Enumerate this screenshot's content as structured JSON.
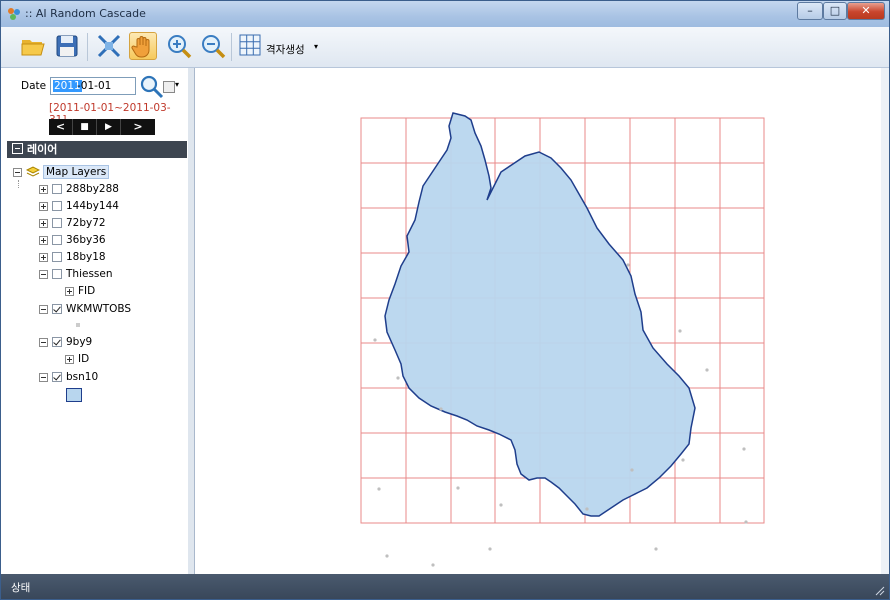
{
  "window": {
    "title": ":: AI Random Cascade",
    "minimize_label": "–",
    "maximize_label": "□",
    "close_label": "✕"
  },
  "toolbar": {
    "grid_create_label": "격자생성",
    "grid_create_arrow": "▾",
    "buttons": [
      "open-folder-icon",
      "save-icon",
      "zoom-extent-icon",
      "pan-hand-icon",
      "zoom-in-icon",
      "zoom-out-icon",
      "grid-icon"
    ]
  },
  "date_panel": {
    "date_label": "Date",
    "date_year_selected": "2011",
    "date_rest": "-01-01",
    "range_text": "[2011-01-01~2011-03-31]",
    "nav": {
      "prev": "<",
      "stop": "■",
      "play": "▶",
      "next": ">"
    }
  },
  "layers_panel": {
    "header": "레이어",
    "root": "Map Layers",
    "items": [
      {
        "label": "288by288",
        "checked": false,
        "expanded": false
      },
      {
        "label": "144by144",
        "checked": false,
        "expanded": false
      },
      {
        "label": "72by72",
        "checked": false,
        "expanded": false
      },
      {
        "label": "36by36",
        "checked": false,
        "expanded": false
      },
      {
        "label": "18by18",
        "checked": false,
        "expanded": false
      },
      {
        "label": "Thiessen",
        "checked": false,
        "expanded": true,
        "child": "FID"
      },
      {
        "label": "WKMWTOBS",
        "checked": true,
        "expanded": true
      },
      {
        "label": "9by9",
        "checked": true,
        "expanded": true,
        "child": "ID"
      },
      {
        "label": "bsn10",
        "checked": true,
        "expanded": true
      }
    ]
  },
  "map": {
    "grid_color": "#e88a8a",
    "basin_fill": "#b8d6ee",
    "basin_stroke": "#1f3e8c",
    "point_color": "#bfbfbf"
  },
  "status": {
    "text": "상태"
  }
}
